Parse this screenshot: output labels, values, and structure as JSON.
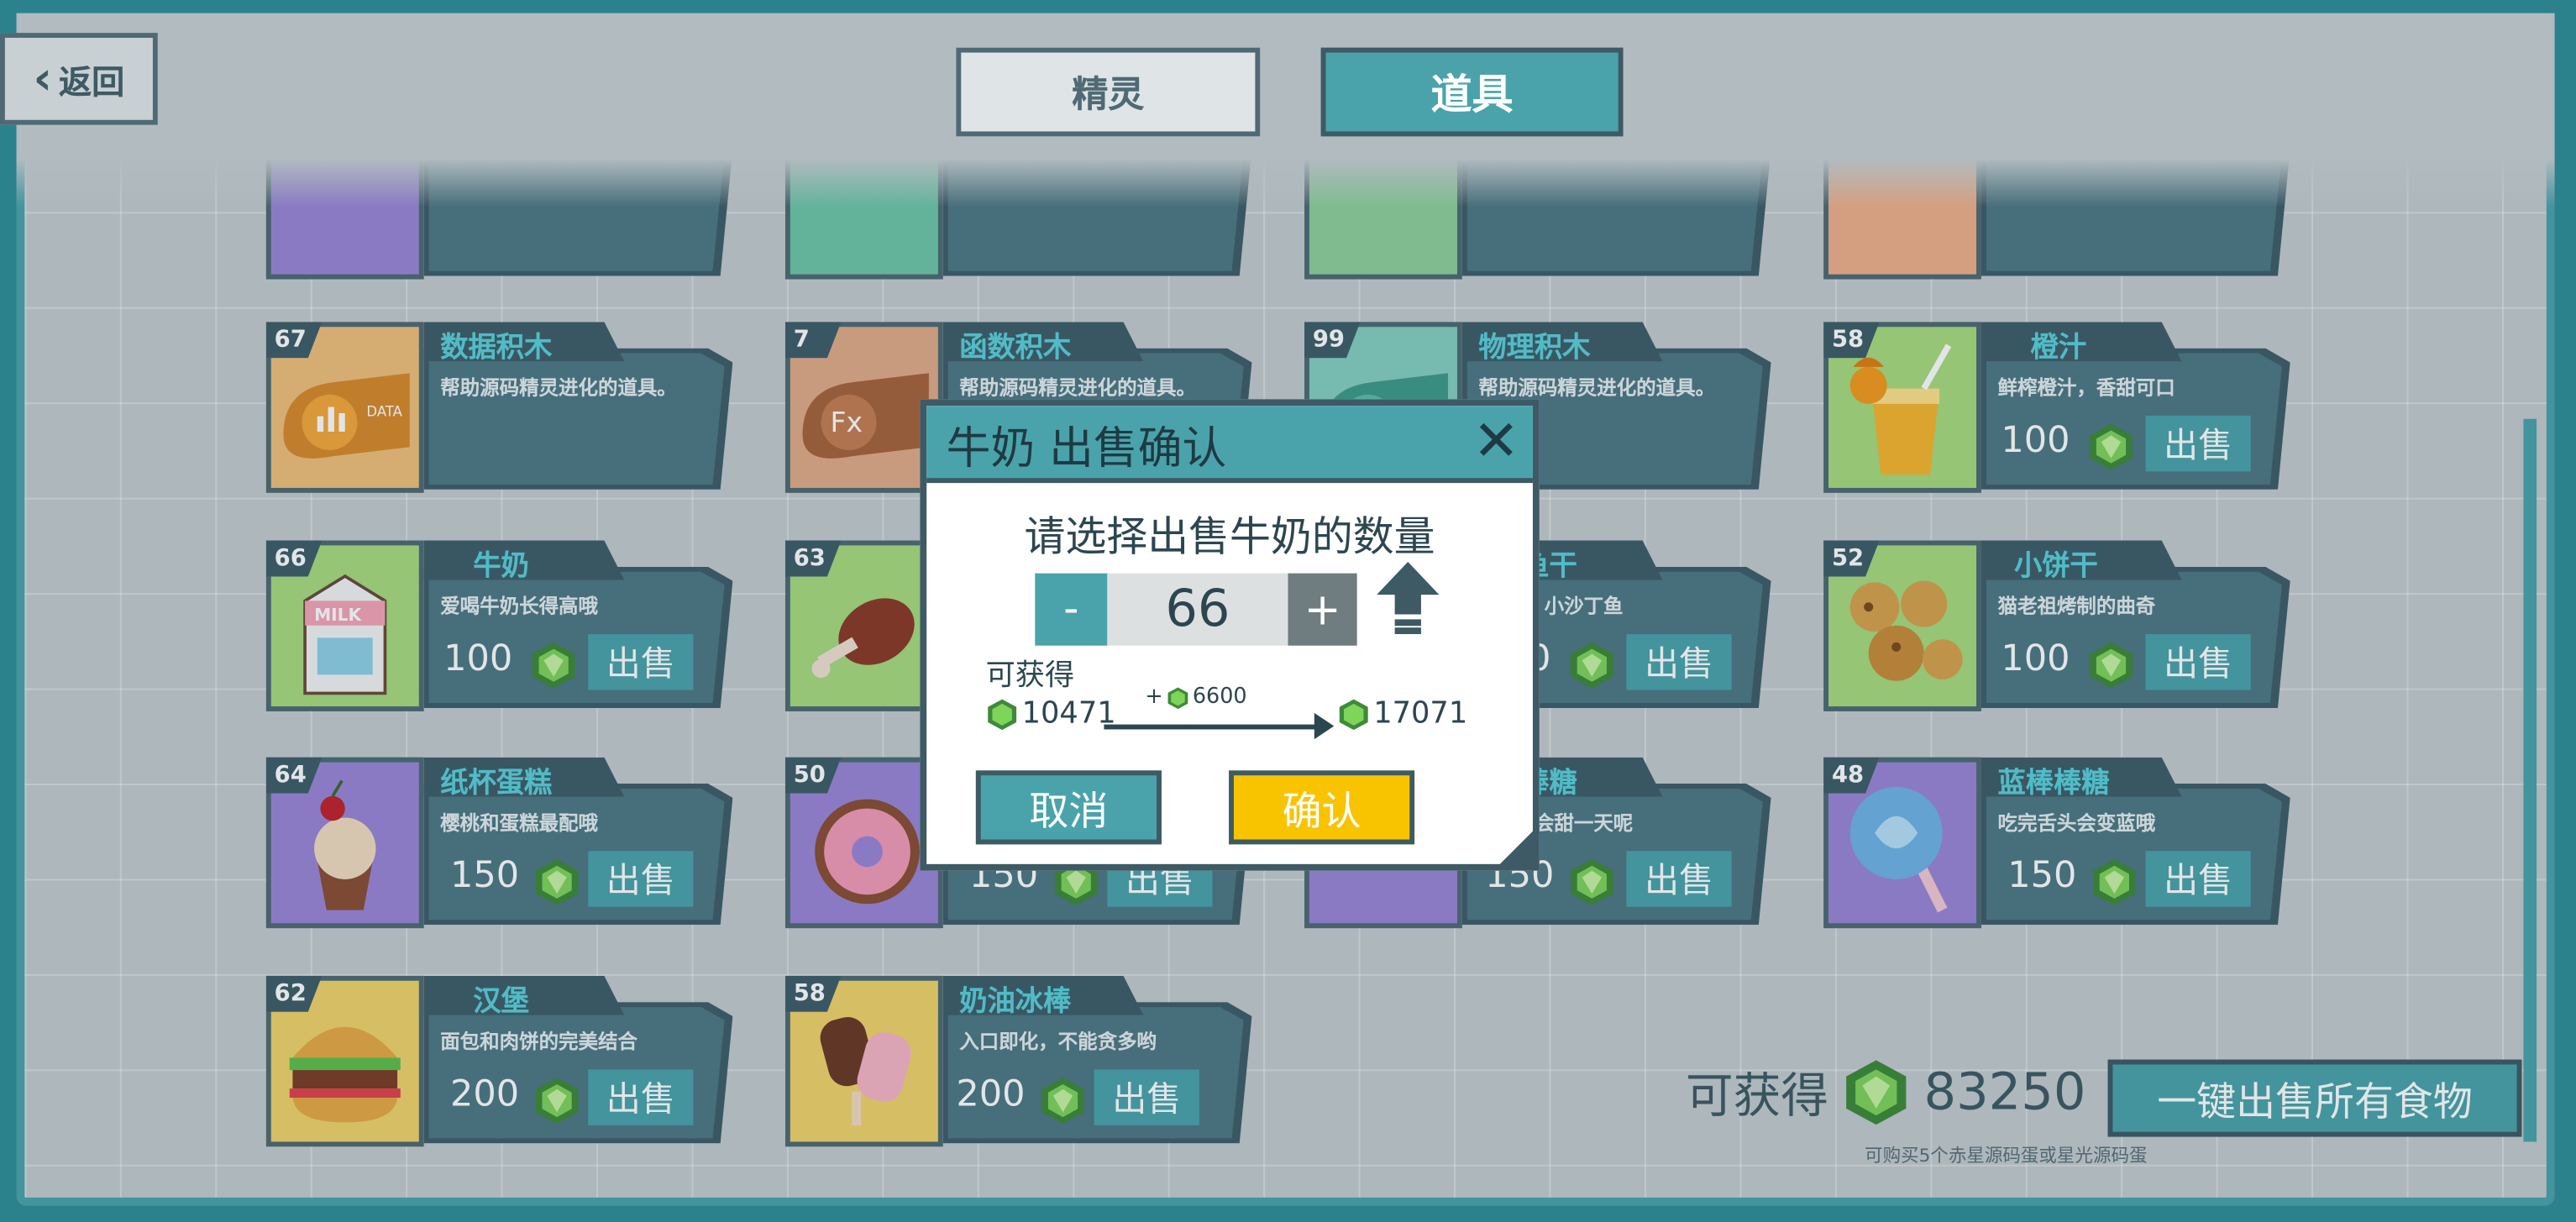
{
  "nav": {
    "back_label": "返回"
  },
  "tabs": {
    "sprites": "精灵",
    "items": "道具"
  },
  "cards": [
    {
      "name": "数据积木",
      "count": "67",
      "desc": "帮助源码精灵进化的道具。",
      "price": "",
      "sell": ""
    },
    {
      "name": "函数积木",
      "count": "7",
      "desc": "帮助源码精灵进化的道具。",
      "price": "",
      "sell": ""
    },
    {
      "name": "物理积木",
      "count": "99",
      "desc": "帮助源码精灵进化的道具。",
      "price": "",
      "sell": ""
    },
    {
      "name": "橙汁",
      "count": "58",
      "desc": "鲜榨橙汁，香甜可口",
      "price": "100",
      "sell": "出售"
    },
    {
      "name": "牛奶",
      "count": "66",
      "desc": "爱喝牛奶长得高哦",
      "price": "100",
      "sell": "出售"
    },
    {
      "name": "",
      "count": "63",
      "desc": "",
      "price": "",
      "sell": ""
    },
    {
      "name": "鱼干",
      "count": "",
      "desc": "小沙丁鱼",
      "price": "0",
      "sell": "出售"
    },
    {
      "name": "小饼干",
      "count": "52",
      "desc": "猫老祖烤制的曲奇",
      "price": "100",
      "sell": "出售"
    },
    {
      "name": "纸杯蛋糕",
      "count": "64",
      "desc": "樱桃和蛋糕最配哦",
      "price": "150",
      "sell": "出售"
    },
    {
      "name": "",
      "count": "50",
      "desc": "",
      "price": "150",
      "sell": "出售"
    },
    {
      "name": "棒糖",
      "count": "",
      "desc": "头会甜一天呢",
      "price": "150",
      "sell": "出售"
    },
    {
      "name": "蓝棒棒糖",
      "count": "48",
      "desc": "吃完舌头会变蓝哦",
      "price": "150",
      "sell": "出售"
    },
    {
      "name": "汉堡",
      "count": "62",
      "desc": "面包和肉饼的完美结合",
      "price": "200",
      "sell": "出售"
    },
    {
      "name": "奶油冰棒",
      "count": "58",
      "desc": "入口即化，不能贪多哟",
      "price": "200",
      "sell": "出售"
    }
  ],
  "footer": {
    "earn_label": "可获得",
    "earn_total": "83250",
    "sell_all_label": "一键出售所有食物",
    "hint": "可购买5个赤星源码蛋或星光源码蛋"
  },
  "modal": {
    "title": "牛奶 出售确认",
    "close": "✕",
    "question": "请选择出售牛奶的数量",
    "minus": "-",
    "quantity": "66",
    "plus": "+",
    "can_get_label": "可获得",
    "from_value": "10471",
    "delta_prefix": "+",
    "delta_value": "6600",
    "to_value": "17071",
    "cancel_label": "取消",
    "confirm_label": "确认"
  },
  "colors": {
    "teal": "#4aa3ab",
    "dark": "#3e5a64",
    "gem": "#6cc94b",
    "confirm": "#f8c400"
  },
  "icons": [
    "back-chevron-icon",
    "gem-icon",
    "close-icon",
    "max-arrow-icon"
  ]
}
